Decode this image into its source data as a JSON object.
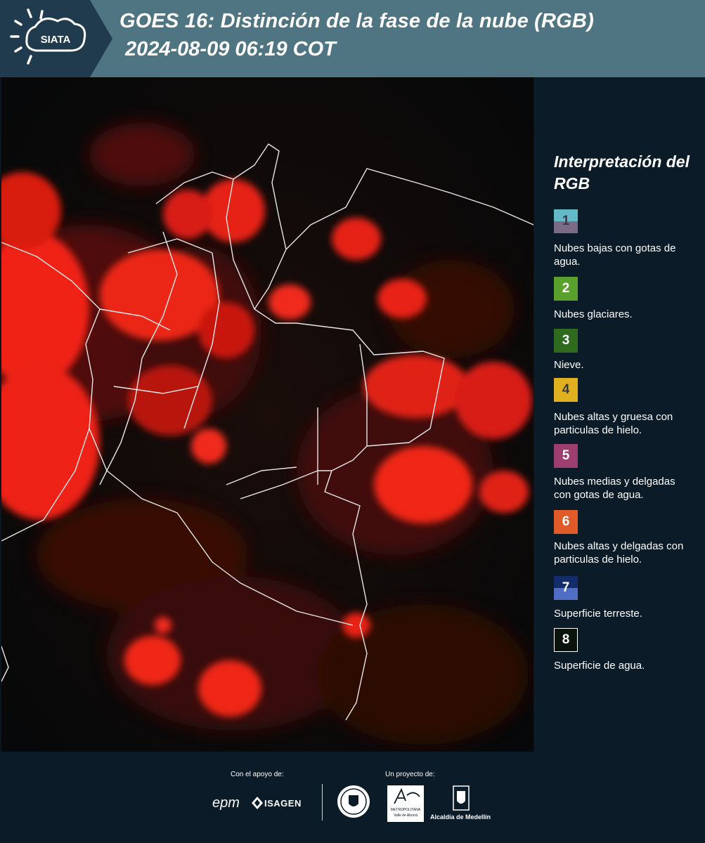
{
  "header": {
    "logo_text": "SIATA",
    "title_line1": "GOES 16: Distinción de la fase de la nube (RGB)",
    "title_line2": "2024-08-09 06:19 COT"
  },
  "legend": {
    "title": "Interpretación del RGB",
    "items": [
      {
        "num": "1",
        "label": "Nubes bajas con gotas de agua.",
        "color_top": "#63b9c6",
        "color_bottom": "#7a6b87"
      },
      {
        "num": "2",
        "label": "Nubes glaciares.",
        "color": "#5aa02c"
      },
      {
        "num": "3",
        "label": "Nieve.",
        "color": "#2e6b1f"
      },
      {
        "num": "4",
        "label": "Nubes altas y gruesa con particulas de hielo.",
        "color": "#e0b020"
      },
      {
        "num": "5",
        "label": "Nubes medias y delgadas con gotas de agua.",
        "color": "#9c3f6e"
      },
      {
        "num": "6",
        "label": "Nubes altas y delgadas con particulas de hielo.",
        "color": "#e05a2a"
      },
      {
        "num": "7",
        "label": "Superficie terreste.",
        "color_top": "#132d6b",
        "color_bottom": "#4f6ec4"
      },
      {
        "num": "8",
        "label": "Superficie de agua.",
        "color": "#0a140d"
      }
    ]
  },
  "footer": {
    "support_label": "Con el apoyo de:",
    "project_label": "Un proyecto de:",
    "sponsor1": "epm",
    "sponsor2": "ISAGEN",
    "partner1_line1": "METROPOLITANA",
    "partner1_line2": "Valle de Aburrá",
    "partner2": "Alcaldía de Medellín"
  }
}
